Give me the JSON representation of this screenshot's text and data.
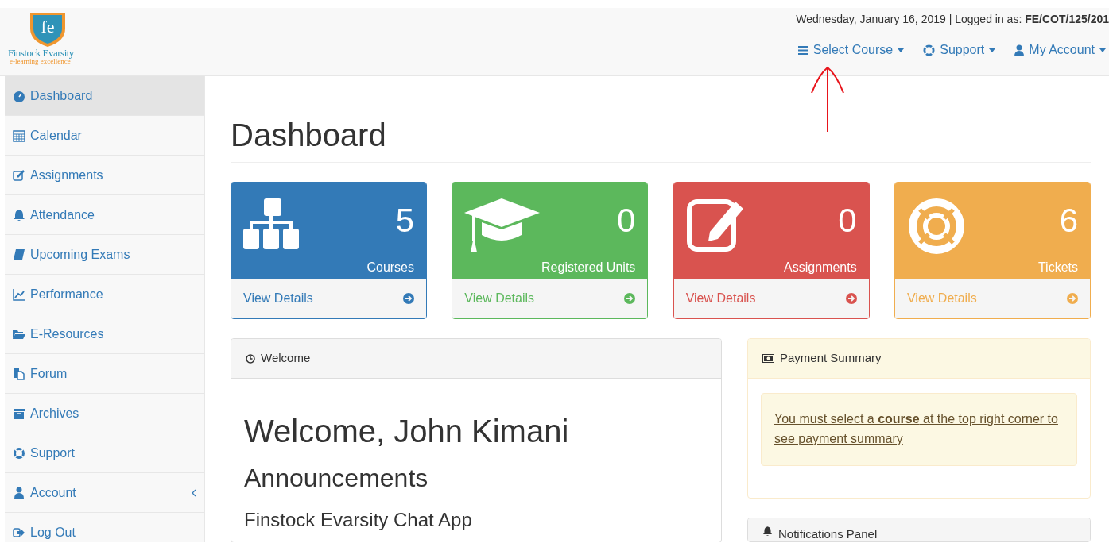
{
  "logo": {
    "letters": "fe",
    "name": "Finstock Evarsity",
    "tagline": "e-learning excellence"
  },
  "header": {
    "info": "Wednesday, January 16, 2019 | Logged in as: **FE/COT/125/201**",
    "menus": [
      {
        "label": "Select Course"
      },
      {
        "label": "Support"
      },
      {
        "label": "My Account"
      }
    ]
  },
  "sidebar": {
    "items": [
      {
        "label": "Dashboard",
        "selected": true
      },
      {
        "label": "Calendar",
        "selected": false
      },
      {
        "label": "Assignments",
        "selected": false
      },
      {
        "label": "Attendance",
        "selected": false
      },
      {
        "label": "Upcoming Exams",
        "selected": false
      },
      {
        "label": "Performance",
        "selected": false
      },
      {
        "label": "E-Resources",
        "selected": false
      },
      {
        "label": "Forum",
        "selected": false
      },
      {
        "label": "Archives",
        "selected": false
      },
      {
        "label": "Support",
        "selected": false
      },
      {
        "label": "Account",
        "selected": false
      },
      {
        "label": "Log Out",
        "selected": false
      }
    ]
  },
  "page_title": "Dashboard",
  "stat_cards": [
    {
      "count": "5",
      "label": "Courses",
      "link": "View Details",
      "color": "#337ab7"
    },
    {
      "count": "0",
      "label": "Registered Units",
      "link": "View Details",
      "color": "#5cb85c"
    },
    {
      "count": "0",
      "label": "Assignments",
      "link": "View Details",
      "color": "#d9534f"
    },
    {
      "count": "6",
      "label": "Tickets",
      "link": "View Details",
      "color": "#f0ad4e"
    }
  ],
  "welcome_panel": {
    "title": "Welcome",
    "greeting": "Welcome, John Kimani",
    "subheading": "Announcements",
    "item": "Finstock Evarsity Chat App"
  },
  "payment_panel": {
    "title": "Payment Summary",
    "message": "You must select a **course** at the top right corner to see payment summary"
  },
  "notifications_panel": {
    "title": "Notifications Panel"
  }
}
